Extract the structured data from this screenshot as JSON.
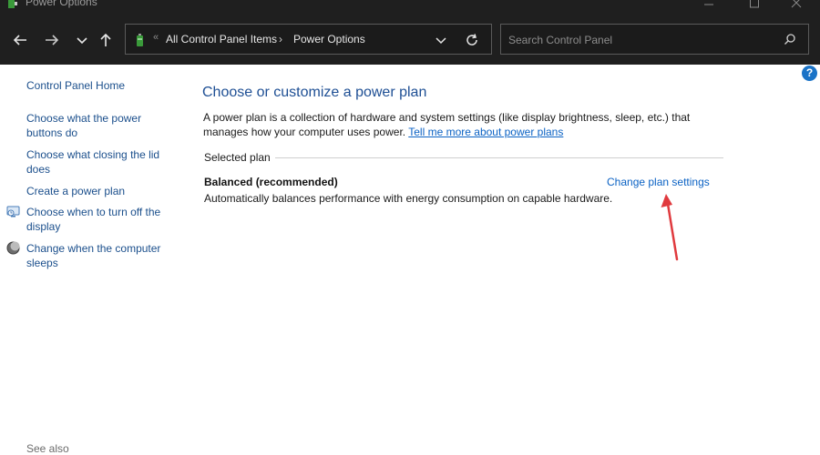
{
  "window": {
    "title": "Power Options"
  },
  "address_bar": {
    "separator": "«",
    "crumbs": [
      "All Control Panel Items",
      "Power Options"
    ],
    "crumb_arrow": "›"
  },
  "search": {
    "placeholder": "Search Control Panel"
  },
  "left_pane": {
    "home_link": "Control Panel Home",
    "links": [
      "Choose what the power buttons do",
      "Choose what closing the lid does",
      "Create a power plan",
      "Choose when to turn off the display",
      "Change when the computer sleeps"
    ],
    "see_also": "See also"
  },
  "main": {
    "help": "?",
    "title": "Choose or customize a power plan",
    "description": "A power plan is a collection of hardware and system settings (like display brightness, sleep, etc.) that manages how your computer uses power.",
    "description_link": "Tell me more about power plans",
    "section_label": "Selected plan",
    "plan": {
      "name": "Balanced (recommended)",
      "description": "Automatically balances performance with energy consumption on capable hardware.",
      "settings_link": "Change plan settings"
    }
  },
  "colors": {
    "chrome_bg": "#1f1f1f",
    "link": "#0b62c4",
    "title": "#1e4f94",
    "annotation_arrow": "#e03a3e"
  }
}
